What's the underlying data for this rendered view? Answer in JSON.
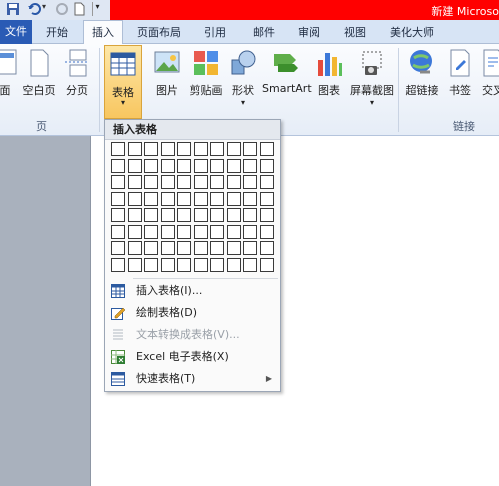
{
  "window": {
    "title": "新建 Microso"
  },
  "tabs": {
    "file": "文件",
    "home": "开始",
    "insert": "插入",
    "layout": "页面布局",
    "references": "引用",
    "mailings": "邮件",
    "review": "审阅",
    "view": "视图",
    "beautify": "美化大师"
  },
  "ribbon": {
    "cover": "面",
    "blank_page": "空白页",
    "page_break": "分页",
    "table": "表格",
    "picture": "图片",
    "clipart": "剪贴画",
    "shapes": "形状",
    "smartart": "SmartArt",
    "chart": "图表",
    "screenshot": "屏幕截图",
    "hyperlink": "超链接",
    "bookmark": "书签",
    "crossref": "交叉",
    "group_pages": "页",
    "group_links": "链接"
  },
  "dropdown": {
    "header": "插入表格",
    "grid": {
      "rows": 8,
      "cols": 10
    },
    "items": [
      {
        "label": "插入表格(I)...",
        "icon": "insert-table-icon",
        "enabled": true
      },
      {
        "label": "绘制表格(D)",
        "icon": "draw-table-icon",
        "enabled": true
      },
      {
        "label": "文本转换成表格(V)...",
        "icon": "convert-text-icon",
        "enabled": false
      },
      {
        "label": "Excel 电子表格(X)",
        "icon": "excel-icon",
        "enabled": true
      },
      {
        "label": "快速表格(T)",
        "icon": "quick-table-icon",
        "enabled": true,
        "submenu": true
      }
    ]
  },
  "colors": {
    "title_bar": "#ff0000",
    "file_tab": "#2a5bb5",
    "table_highlight": "#f8c660"
  }
}
